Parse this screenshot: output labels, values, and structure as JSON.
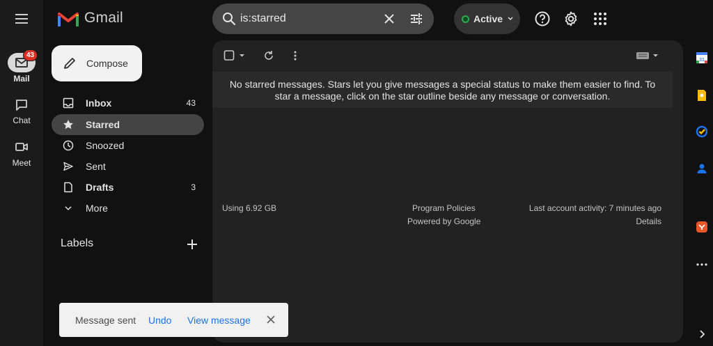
{
  "app": {
    "name": "Gmail"
  },
  "rail": {
    "mail": {
      "label": "Mail",
      "badge": "43"
    },
    "chat": {
      "label": "Chat"
    },
    "meet": {
      "label": "Meet"
    }
  },
  "search": {
    "value": "is:starred"
  },
  "status": {
    "label": "Active",
    "color": "#34a853"
  },
  "compose": {
    "label": "Compose"
  },
  "nav": [
    {
      "label": "Inbox",
      "count": "43",
      "icon": "inbox-icon"
    },
    {
      "label": "Starred",
      "count": "",
      "icon": "star-icon"
    },
    {
      "label": "Snoozed",
      "count": "",
      "icon": "clock-icon"
    },
    {
      "label": "Sent",
      "count": "",
      "icon": "send-icon"
    },
    {
      "label": "Drafts",
      "count": "3",
      "icon": "draft-icon"
    },
    {
      "label": "More",
      "count": "",
      "icon": "chevron-down-icon"
    }
  ],
  "labels": {
    "title": "Labels"
  },
  "main": {
    "empty_message": "No starred messages. Stars let you give messages a special status to make them easier to find. To star a message, click on the star outline beside any message or conversation.",
    "footer": {
      "storage": "Using 6.92 GB",
      "policies": "Program Policies",
      "powered": "Powered by Google",
      "activity": "Last account activity: 7 minutes ago",
      "details": "Details"
    }
  },
  "snackbar": {
    "text": "Message sent",
    "undo": "Undo",
    "view": "View message"
  },
  "colors": {
    "accent": "#1a73e8",
    "badge": "#d93025",
    "active_nav": "#444444"
  }
}
